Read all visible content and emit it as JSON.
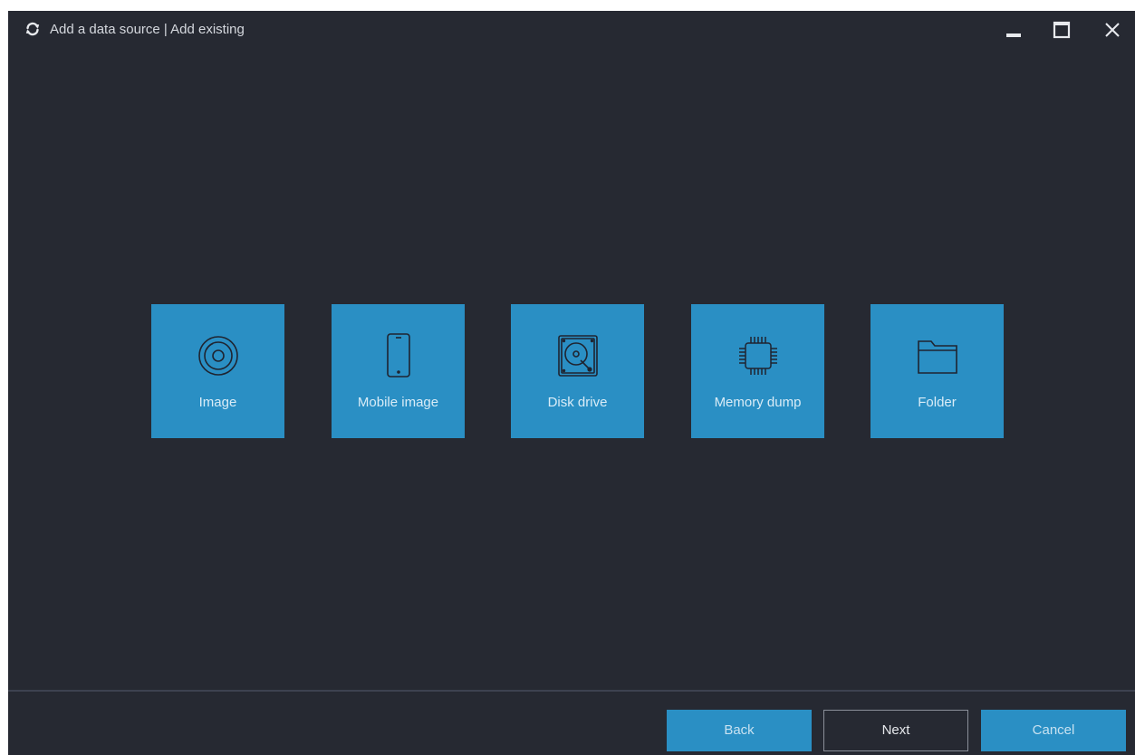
{
  "window": {
    "title": "Add a data source | Add existing",
    "app_icon": "refresh-icon",
    "controls": {
      "minimize": "minimize-icon",
      "maximize": "maximize-icon",
      "close": "close-icon"
    }
  },
  "sources": [
    {
      "label": "Image",
      "icon": "disc-icon"
    },
    {
      "label": "Mobile image",
      "icon": "smartphone-icon"
    },
    {
      "label": "Disk drive",
      "icon": "hard-drive-icon"
    },
    {
      "label": "Memory dump",
      "icon": "chip-icon"
    },
    {
      "label": "Folder",
      "icon": "folder-icon"
    }
  ],
  "footer": {
    "back_label": "Back",
    "next_label": "Next",
    "cancel_label": "Cancel"
  },
  "colors": {
    "background": "#262932",
    "accent": "#2a8fc4",
    "title_text": "#d5d8de"
  }
}
